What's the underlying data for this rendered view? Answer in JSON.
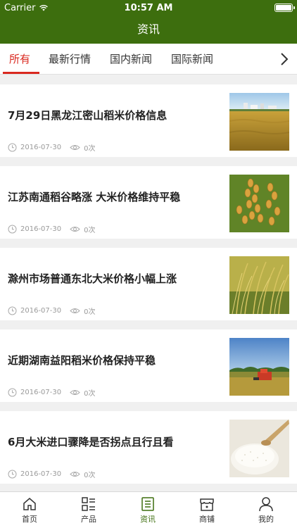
{
  "status": {
    "carrier": "Carrier",
    "time": "10:57 AM"
  },
  "nav": {
    "title": "资讯"
  },
  "tabs": [
    "所有",
    "最新行情",
    "国内新闻",
    "国际新闻"
  ],
  "articles": [
    {
      "title": "7月29日黑龙江密山稻米价格信息",
      "date": "2016-07-30",
      "views": "0次",
      "image": "rice-field-with-buildings-photo"
    },
    {
      "title": "江苏南通稻谷略涨 大米价格维持平稳",
      "date": "2016-07-30",
      "views": "0次",
      "image": "rice-grain-closeup-photo"
    },
    {
      "title": "滁州市场普通东北大米价格小幅上涨",
      "date": "2016-07-30",
      "views": "0次",
      "image": "rice-stalks-photo"
    },
    {
      "title": "近期湖南益阳稻米价格保持平稳",
      "date": "2016-07-30",
      "views": "0次",
      "image": "rice-harvester-photo"
    },
    {
      "title": "6月大米进口骤降是否拐点且行且看",
      "date": "2016-07-30",
      "views": "0次",
      "image": "white-rice-bowl-photo"
    }
  ],
  "tabbar": [
    "首页",
    "产品",
    "资讯",
    "商铺",
    "我的"
  ],
  "colors": {
    "brand_green": "#3d6e0e",
    "active_tab_red": "#d9281f"
  }
}
